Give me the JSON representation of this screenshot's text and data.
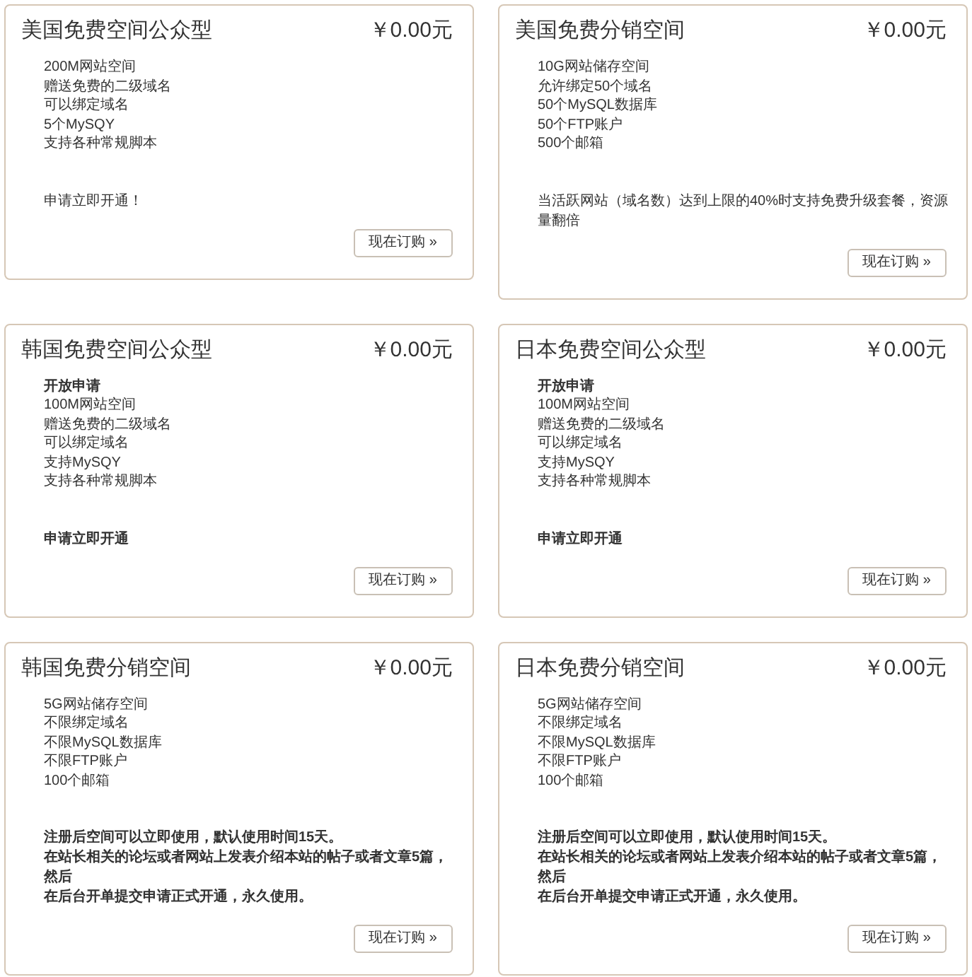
{
  "plans": [
    {
      "title": "美国免费空间公众型",
      "price": "￥0.00元",
      "features": [
        {
          "text": "200M网站空间",
          "bold": false
        },
        {
          "text": "赠送免费的二级域名",
          "bold": false
        },
        {
          "text": "可以绑定域名",
          "bold": false
        },
        {
          "text": "5个MySQY",
          "bold": false
        },
        {
          "text": "支持各种常规脚本",
          "bold": false
        }
      ],
      "notes": [
        {
          "text": "申请立即开通！",
          "bold": false
        }
      ],
      "button": "现在订购 »"
    },
    {
      "title": "美国免费分销空间",
      "price": "￥0.00元",
      "features": [
        {
          "text": "10G网站储存空间",
          "bold": false
        },
        {
          "text": "允许绑定50个域名",
          "bold": false
        },
        {
          "text": "50个MySQL数据库",
          "bold": false
        },
        {
          "text": "50个FTP账户",
          "bold": false
        },
        {
          "text": "500个邮箱",
          "bold": false
        }
      ],
      "notes": [
        {
          "text": "当活跃网站（域名数）达到上限的40%时支持免费升级套餐，资源量翻倍",
          "bold": false
        }
      ],
      "button": "现在订购 »"
    },
    {
      "title": "韩国免费空间公众型",
      "price": "￥0.00元",
      "features": [
        {
          "text": "开放申请",
          "bold": true
        },
        {
          "text": "100M网站空间",
          "bold": false
        },
        {
          "text": "赠送免费的二级域名",
          "bold": false
        },
        {
          "text": "可以绑定域名",
          "bold": false
        },
        {
          "text": "支持MySQY",
          "bold": false
        },
        {
          "text": "支持各种常规脚本",
          "bold": false
        }
      ],
      "notes": [
        {
          "text": "申请立即开通",
          "bold": true
        }
      ],
      "button": "现在订购 »"
    },
    {
      "title": "日本免费空间公众型",
      "price": "￥0.00元",
      "features": [
        {
          "text": "开放申请",
          "bold": true
        },
        {
          "text": "100M网站空间",
          "bold": false
        },
        {
          "text": "赠送免费的二级域名",
          "bold": false
        },
        {
          "text": "可以绑定域名",
          "bold": false
        },
        {
          "text": "支持MySQY",
          "bold": false
        },
        {
          "text": "支持各种常规脚本",
          "bold": false
        }
      ],
      "notes": [
        {
          "text": "申请立即开通",
          "bold": true
        }
      ],
      "button": "现在订购 »"
    },
    {
      "title": "韩国免费分销空间",
      "price": "￥0.00元",
      "features": [
        {
          "text": "5G网站储存空间",
          "bold": false
        },
        {
          "text": "不限绑定域名",
          "bold": false
        },
        {
          "text": "不限MySQL数据库",
          "bold": false
        },
        {
          "text": "不限FTP账户",
          "bold": false
        },
        {
          "text": "100个邮箱",
          "bold": false
        }
      ],
      "notes": [
        {
          "text": "注册后空间可以立即使用，默认使用时间15天。",
          "bold": true
        },
        {
          "text": "在站长相关的论坛或者网站上发表介绍本站的帖子或者文章5篇，然后",
          "bold": true
        },
        {
          "text": "在后台开单提交申请正式开通，永久使用。",
          "bold": true
        }
      ],
      "button": "现在订购 »"
    },
    {
      "title": "日本免费分销空间",
      "price": "￥0.00元",
      "features": [
        {
          "text": "5G网站储存空间",
          "bold": false
        },
        {
          "text": "不限绑定域名",
          "bold": false
        },
        {
          "text": "不限MySQL数据库",
          "bold": false
        },
        {
          "text": "不限FTP账户",
          "bold": false
        },
        {
          "text": "100个邮箱",
          "bold": false
        }
      ],
      "notes": [
        {
          "text": "注册后空间可以立即使用，默认使用时间15天。",
          "bold": true
        },
        {
          "text": "在站长相关的论坛或者网站上发表介绍本站的帖子或者文章5篇，然后",
          "bold": true
        },
        {
          "text": "在后台开单提交申请正式开通，永久使用。",
          "bold": true
        }
      ],
      "button": "现在订购 »"
    }
  ]
}
